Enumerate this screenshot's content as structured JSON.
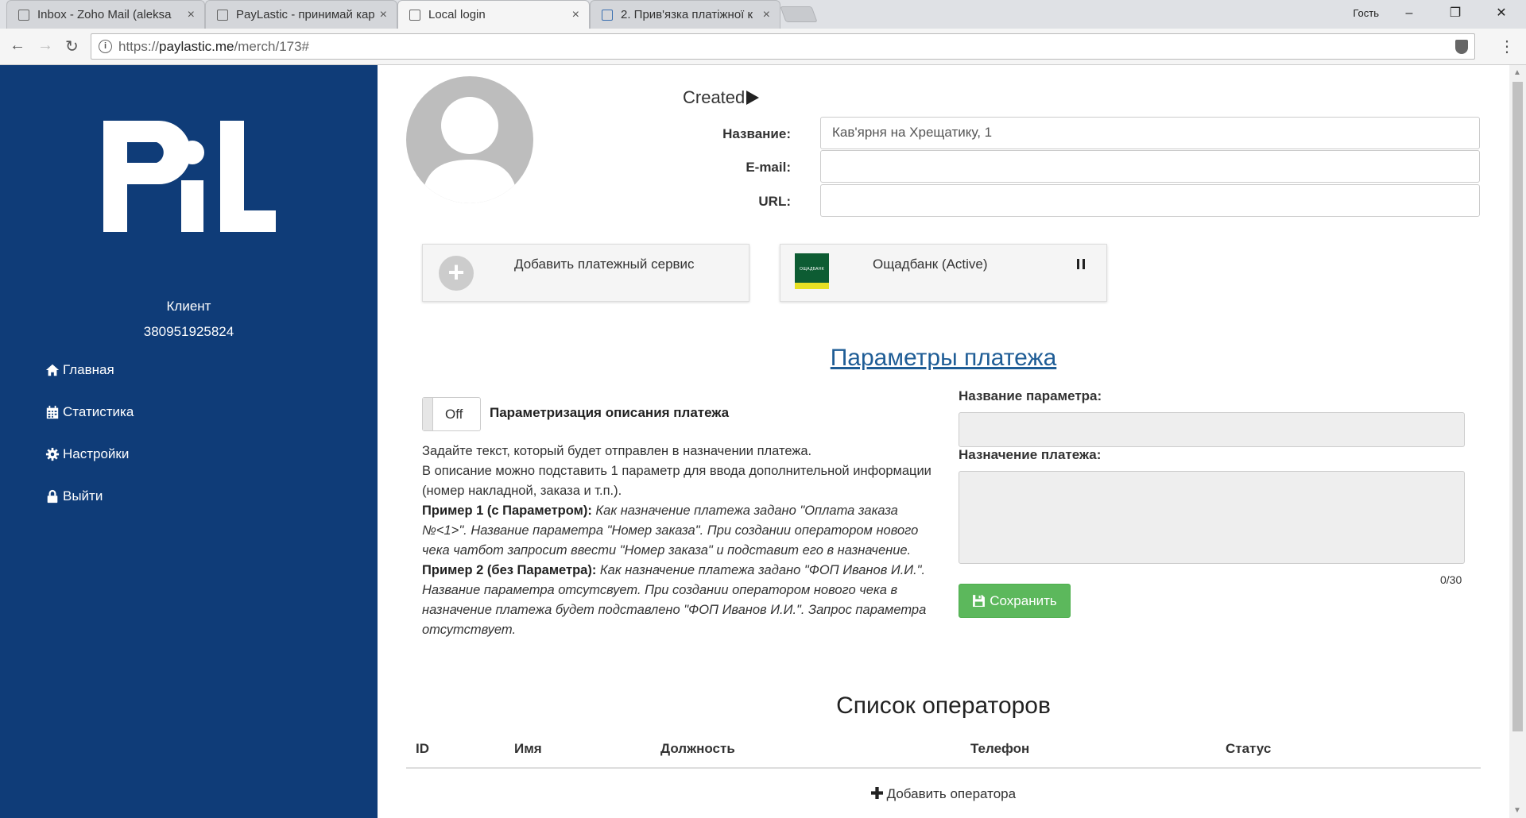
{
  "browser": {
    "tabs": [
      {
        "title": "Inbox - Zoho Mail (aleksa",
        "close": "×"
      },
      {
        "title": "PayLastic - принимай кар",
        "close": "×"
      },
      {
        "title": "Local login",
        "close": "×"
      },
      {
        "title": "2. Прив'язка платіжної к",
        "close": "×"
      }
    ],
    "guest_label": "Гость",
    "url_prefix": "https://",
    "url_host": "paylastic.me",
    "url_path": "/merch/173#",
    "controls": {
      "minimize": "–",
      "maximize": "❐",
      "close": "✕"
    }
  },
  "sidebar": {
    "logo_text": "PL",
    "client_label": "Клиент",
    "client_phone": "380951925824",
    "menu": [
      {
        "label": "Главная",
        "icon": "home-icon"
      },
      {
        "label": "Статистика",
        "icon": "calendar-icon"
      },
      {
        "label": "Настройки",
        "icon": "gear-icon"
      },
      {
        "label": "Выйти",
        "icon": "lock-icon"
      }
    ]
  },
  "merchant": {
    "status": "Created",
    "fields": {
      "name_label": "Название:",
      "name_value": "Кав'ярня на Хрещатику, 1",
      "email_label": "E-mail:",
      "email_value": "",
      "url_label": "URL:",
      "url_value": ""
    }
  },
  "services": {
    "add_label": "Добавить платежный сервис",
    "bank_label": "Ощадбанк (Active)",
    "bank_logo_text": "ОЩАДБАНК"
  },
  "payment_params": {
    "title": "Параметры платежа",
    "toggle_state": "Off",
    "toggle_label": "Параметризация описания платежа",
    "desc_line1": "Задайте текст, который будет отправлен в назначении платежа.",
    "desc_line2": "В описание можно подставить 1 параметр для ввода дополнительной информации (номер накладной, заказа и т.п.).",
    "example1_title": "Пример 1 (с Параметром):",
    "example1_text": "Как назначение платежа задано \"Оплата заказа №<1>\". Название параметра \"Номер заказа\". При создании оператором нового чека чатбот запросит ввести \"Номер заказа\" и подставит его в назначение.",
    "example2_title": "Пример 2 (без Параметра):",
    "example2_text": "Как назначение платежа задано \"ФОП Иванов И.И.\". Название параметра отсутсвует. При создании оператором нового чека в назначение платежа будет подставлено \"ФОП Иванов И.И.\". Запрос параметра отсутствует.",
    "param_name_label": "Название параметра:",
    "param_name_value": "",
    "purpose_label": "Назначение платежа:",
    "purpose_value": "",
    "counter": "0/30",
    "save_label": "Сохранить"
  },
  "operators": {
    "title": "Список операторов",
    "columns": [
      "ID",
      "Имя",
      "Должность",
      "Телефон",
      "Статус"
    ],
    "rows": [],
    "add_label": "Добавить оператора"
  },
  "colors": {
    "sidebar_bg": "#0f3c78",
    "link": "#1f5d96",
    "save_green": "#5cb85c",
    "bank_green": "#0d5c33",
    "bank_yellow": "#e7e024"
  }
}
